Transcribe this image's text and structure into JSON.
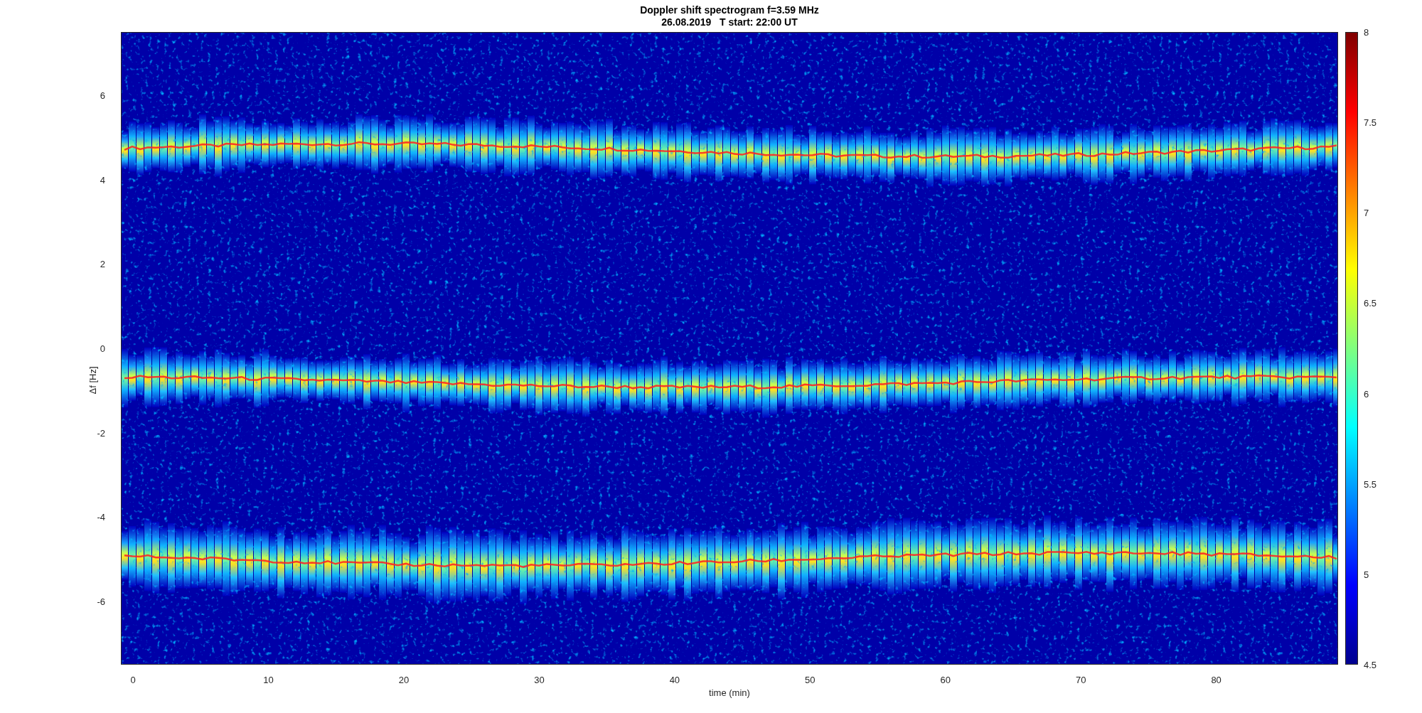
{
  "title": [
    "Doppler shift spectrogram f=3.59 MHz",
    "26.08.2019   T start: 22:00 UT"
  ],
  "y_axis": {
    "label": "Δf [Hz]",
    "ticks": [
      "6",
      "4",
      "2",
      "0",
      "-2",
      "-4",
      "-6"
    ]
  },
  "x_axis": {
    "label": "time (min)",
    "ticks": [
      "0",
      "10",
      "20",
      "30",
      "40",
      "50",
      "60",
      "70",
      "80"
    ]
  },
  "colorbar": {
    "ticks": [
      "8",
      "7.5",
      "7",
      "6.5",
      "6",
      "5.5",
      "5",
      "4.5"
    ]
  }
}
